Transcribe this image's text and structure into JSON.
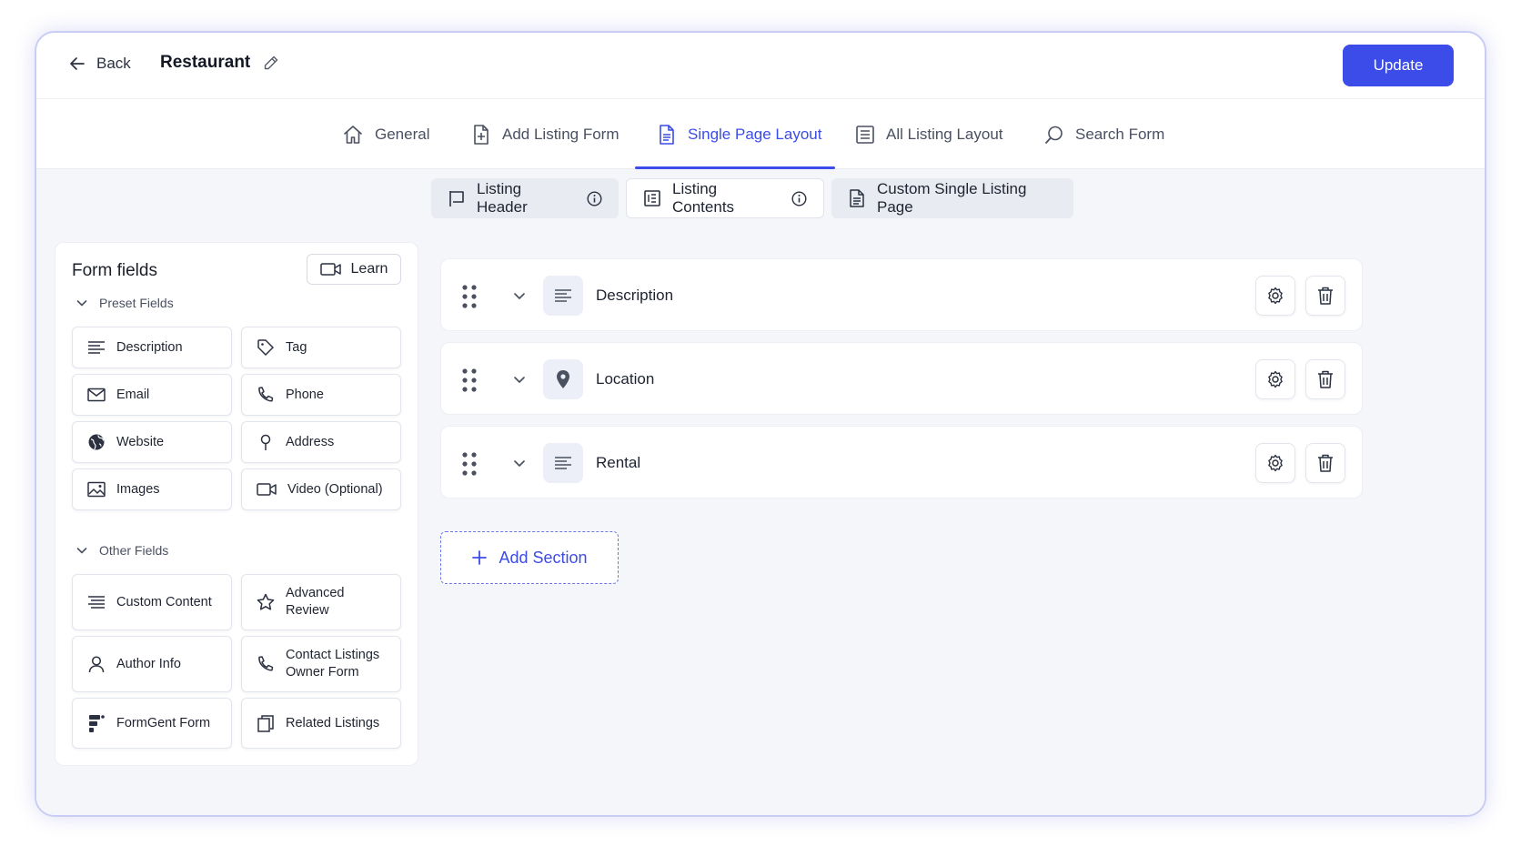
{
  "header": {
    "back_label": "Back",
    "title": "Restaurant",
    "update_label": "Update"
  },
  "tabs": [
    {
      "label": "General",
      "icon": "home-icon"
    },
    {
      "label": "Add Listing Form",
      "icon": "file-plus-icon"
    },
    {
      "label": "Single Page Layout",
      "icon": "document-icon",
      "active": true
    },
    {
      "label": "All Listing Layout",
      "icon": "layout-list-icon"
    },
    {
      "label": "Search Form",
      "icon": "search-icon"
    }
  ],
  "subtabs": [
    {
      "label": "Listing Header",
      "icon": "header-flag-icon",
      "info": true
    },
    {
      "label": "Listing Contents",
      "icon": "contents-icon",
      "info": true,
      "active": true
    },
    {
      "label": "Custom Single Listing Page",
      "icon": "document-icon"
    }
  ],
  "sidebar": {
    "title": "Form fields",
    "learn_label": "Learn",
    "preset_label": "Preset Fields",
    "other_label": "Other Fields",
    "preset_fields": [
      {
        "label": "Description",
        "icon": "text-lines-icon"
      },
      {
        "label": "Tag",
        "icon": "tag-icon"
      },
      {
        "label": "Email",
        "icon": "envelope-icon"
      },
      {
        "label": "Phone",
        "icon": "phone-icon"
      },
      {
        "label": "Website",
        "icon": "globe-icon"
      },
      {
        "label": "Address",
        "icon": "pin-icon"
      },
      {
        "label": "Images",
        "icon": "image-icon"
      },
      {
        "label": "Video (Optional)",
        "icon": "video-icon"
      }
    ],
    "other_fields": [
      {
        "label": "Custom Content",
        "icon": "text-lines-icon"
      },
      {
        "label": "Advanced Review",
        "icon": "star-icon"
      },
      {
        "label": "Author Info",
        "icon": "user-icon"
      },
      {
        "label": "Contact Listings Owner Form",
        "icon": "phone-icon"
      },
      {
        "label": "FormGent Form",
        "icon": "formgent-icon"
      },
      {
        "label": "Related Listings",
        "icon": "copy-icon"
      }
    ]
  },
  "sections": [
    {
      "title": "Description",
      "icon": "text-lines-icon"
    },
    {
      "title": "Location",
      "icon": "map-pin-filled-icon"
    },
    {
      "title": "Rental",
      "icon": "text-lines-icon"
    }
  ],
  "add_section_label": "Add Section",
  "colors": {
    "accent": "#3c4ce8",
    "background": "#f5f6fa",
    "border": "#c9cdf3"
  }
}
